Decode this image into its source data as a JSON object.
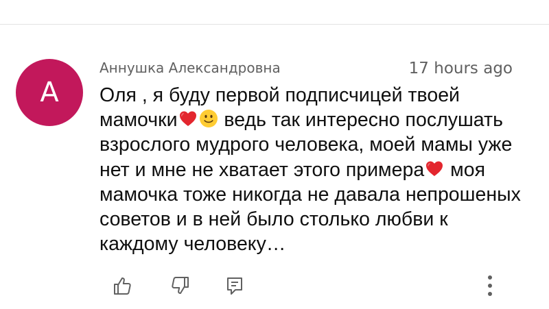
{
  "comment": {
    "avatar_letter": "A",
    "avatar_color": "#c2185b",
    "author": "Аннушка Александровна",
    "timestamp": "17 hours ago",
    "text_lines": [
      {
        "before": "Оля , я буду первой подписчицей твоей",
        "emoji": [],
        "after": ""
      },
      {
        "before": "мамочки",
        "emoji": [
          "red-heart",
          "slightly-smiling-face"
        ],
        "after": " ведь так интересно послушать"
      },
      {
        "before": "взрослого мудрого человека, моей мамы уже",
        "emoji": [],
        "after": ""
      },
      {
        "before": "нет и мне не хватает этого примера",
        "emoji": [
          "red-heart"
        ],
        "after": " моя"
      },
      {
        "before": "мамочка тоже никогда не давала непрошеных",
        "emoji": [],
        "after": ""
      },
      {
        "before": "советов и в ней было столько любви к",
        "emoji": [],
        "after": ""
      },
      {
        "before": "каждому человеку…",
        "emoji": [],
        "after": ""
      }
    ]
  },
  "actions": {
    "icons": [
      "thumbs-up-icon",
      "thumbs-down-icon",
      "reply-icon",
      "more-vert-icon"
    ]
  },
  "colors": {
    "text": "#0f0f0f",
    "secondary_text": "#606060",
    "icon": "#606060",
    "divider": "#e3e3e3",
    "heart": "#e3262e",
    "smiley": "#ffcc33"
  }
}
